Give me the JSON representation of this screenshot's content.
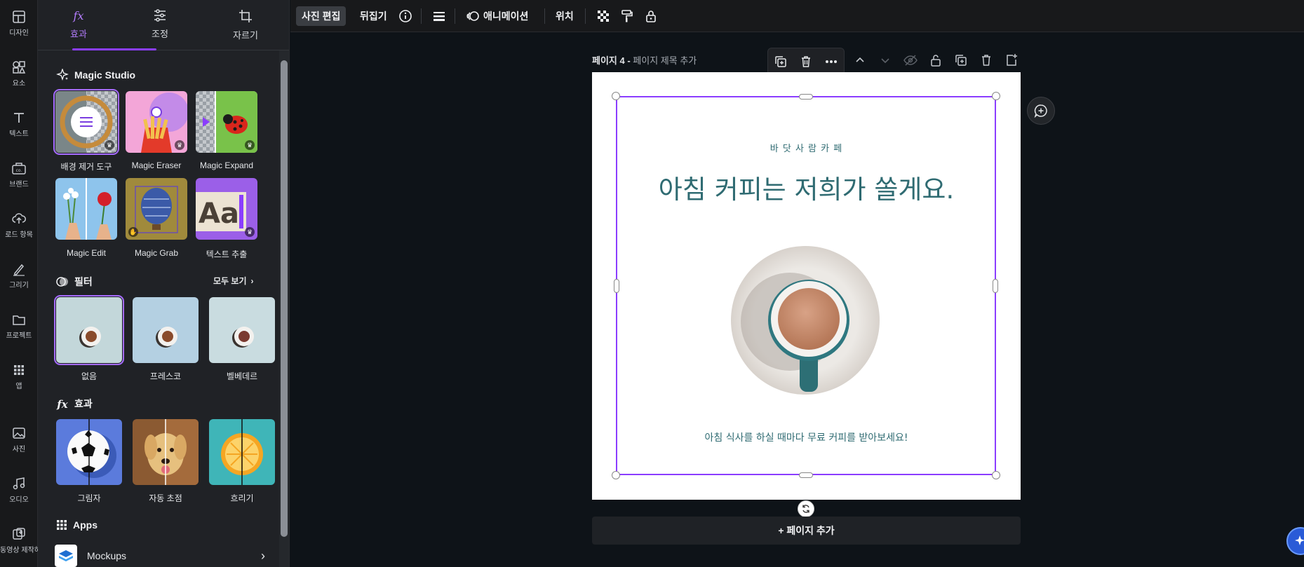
{
  "rail": {
    "items": [
      {
        "label": "디자인",
        "icon": "design-icon"
      },
      {
        "label": "요소",
        "icon": "elements-icon"
      },
      {
        "label": "텍스트",
        "icon": "text-icon"
      },
      {
        "label": "브랜드",
        "icon": "brand-icon"
      },
      {
        "label": "로드 항목",
        "icon": "upload-icon"
      },
      {
        "label": "그리기",
        "icon": "draw-icon"
      },
      {
        "label": "프로젝트",
        "icon": "folder-icon"
      },
      {
        "label": "앱",
        "icon": "apps-icon"
      },
      {
        "label": "사진",
        "icon": "photo-icon"
      },
      {
        "label": "오디오",
        "icon": "audio-icon"
      },
      {
        "label": "동영상 제작하기",
        "icon": "video-create-icon"
      }
    ]
  },
  "panel": {
    "tabs": [
      {
        "label": "효과",
        "icon": "fx-icon",
        "active": true
      },
      {
        "label": "조정",
        "icon": "sliders-icon"
      },
      {
        "label": "자르기",
        "icon": "crop-icon"
      }
    ],
    "magic_studio": {
      "title": "Magic Studio",
      "tools": [
        {
          "label": "배경 제거 도구",
          "selected": true
        },
        {
          "label": "Magic Eraser"
        },
        {
          "label": "Magic Expand"
        },
        {
          "label": "Magic Edit"
        },
        {
          "label": "Magic Grab"
        },
        {
          "label": "텍스트 추출"
        }
      ]
    },
    "filters": {
      "title": "필터",
      "see_all": "모두 보기",
      "items": [
        {
          "label": "없음",
          "selected": true
        },
        {
          "label": "프레스코"
        },
        {
          "label": "벨베데르"
        }
      ]
    },
    "effects": {
      "title": "효과",
      "items": [
        {
          "label": "그림자"
        },
        {
          "label": "자동 초점"
        },
        {
          "label": "흐리기"
        }
      ]
    },
    "apps": {
      "title": "Apps",
      "items": [
        {
          "label": "Mockups"
        }
      ]
    }
  },
  "toolbar": {
    "edit_photo": "사진 편집",
    "flip": "뒤집기",
    "animate": "애니메이션",
    "position": "위치"
  },
  "page": {
    "number_label": "페이지 4 -",
    "title_placeholder": "페이지 제목 추가",
    "design": {
      "brand": "바 닷 사 람   카 페",
      "headline": "아침 커피는 저희가 쏠게요.",
      "subtext": "아침 식사를 하실 때마다 무료 커피를 받아보세요!"
    },
    "add_page": "+ 페이지 추가"
  },
  "colors": {
    "accent": "#8b3dff",
    "teal_text": "#2f6b72",
    "page_bg": "#ffffff"
  }
}
